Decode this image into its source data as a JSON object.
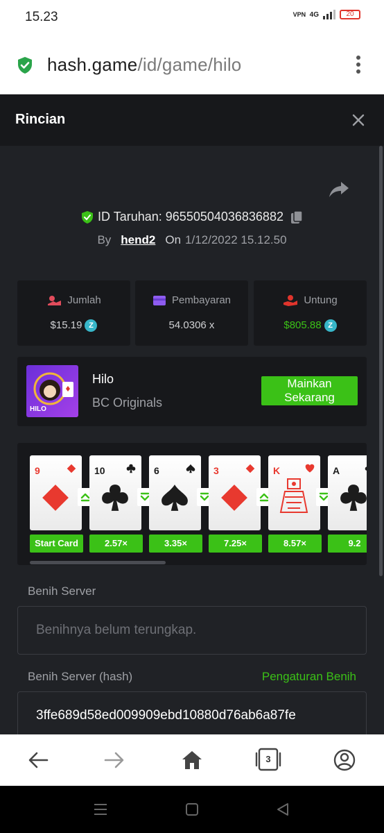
{
  "status_bar": {
    "time": "15.23",
    "vpn": "VPN",
    "network": "4G",
    "battery": "20"
  },
  "browser": {
    "url_host": "hash.game",
    "url_path": "/id/game/hilo",
    "tab_count": "3"
  },
  "modal": {
    "title": "Rincian"
  },
  "bet": {
    "id_label": "ID Taruhan:",
    "id_value": "96550504036836882",
    "by_label": "By",
    "user": "hend2",
    "on_label": "On",
    "date": "1/12/2022 15.12.50"
  },
  "stats": [
    {
      "label": "Jumlah",
      "value": "$15.19",
      "value_color": "#cfd0d3"
    },
    {
      "label": "Pembayaran",
      "value": "54.0306 x",
      "value_color": "#cfd0d3"
    },
    {
      "label": "Untung",
      "value": "$805.88",
      "value_color": "#3bc117"
    }
  ],
  "game": {
    "name": "Hilo",
    "provider": "BC Originals",
    "thumb_label": "HILO",
    "play_button": "Mainkan Sekarang"
  },
  "cards": [
    {
      "rank": "9",
      "suit": "diamond",
      "color": "#e8392f",
      "multiplier": "Start Card",
      "arrow": "up"
    },
    {
      "rank": "10",
      "suit": "club",
      "color": "#1c1c1c",
      "multiplier": "2.57×",
      "arrow": "down"
    },
    {
      "rank": "6",
      "suit": "spade",
      "color": "#1c1c1c",
      "multiplier": "3.35×",
      "arrow": "down"
    },
    {
      "rank": "3",
      "suit": "diamond",
      "color": "#e8392f",
      "multiplier": "7.25×",
      "arrow": "up"
    },
    {
      "rank": "K",
      "suit": "heart",
      "color": "#e8392f",
      "multiplier": "8.57×",
      "arrow": "down"
    },
    {
      "rank": "A",
      "suit": "club",
      "color": "#1c1c1c",
      "multiplier": "9.2",
      "arrow": ""
    }
  ],
  "seeds": {
    "server_label": "Benih Server",
    "server_placeholder": "Benihnya belum terungkap.",
    "hash_label": "Benih Server (hash)",
    "settings_link": "Pengaturan Benih",
    "hash_value": "3ffe689d58ed009909ebd10880d76ab6a87fe"
  },
  "colors": {
    "accent_green": "#3bc117",
    "panel_bg": "#17181b",
    "content_bg": "#202226"
  },
  "icons": {
    "nav_back": "arrow-left-icon",
    "nav_forward": "arrow-right-icon",
    "nav_home": "home-icon",
    "nav_tabs": "tabs-icon",
    "nav_account": "account-icon"
  }
}
